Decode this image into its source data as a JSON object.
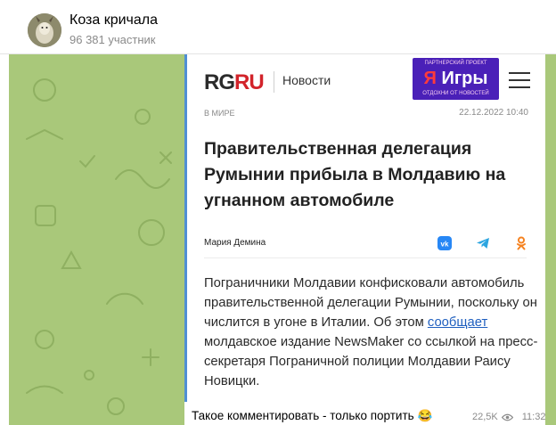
{
  "header": {
    "title": "Коза кричала",
    "subtitle": "96 381 участник"
  },
  "article": {
    "logo_rg": "RG",
    "logo_ru": "RU",
    "section": "Новости",
    "ad_top": "ПАРТНЕРСКИЙ ПРОЕКТ",
    "ad_ya": "Я",
    "ad_main": "Игры",
    "ad_bottom": "ОТДОХНИ ОТ НОВОСТЕЙ",
    "rubric": "В МИРЕ",
    "date": "22.12.2022 10:40",
    "headline": "Правительственная делегация Румынии прибыла в Молдавию на угнанном автомобиле",
    "author": "Мария Демина",
    "body_before_link": "Пограничники Молдавии конфисковали автомобиль правительственной делегации Румынии, поскольку он числится в угоне в Италии. Об этом ",
    "body_link": "сообщает",
    "body_after_link": " молдавское издание NewsMaker со ссылкой на пресс-секретаря Пограничной полиции Молдавии Раису Новицки."
  },
  "message": {
    "caption": "Такое комментировать - только портить 😂",
    "views": "22,5K",
    "time": "11:32"
  },
  "colors": {
    "chat_background": "#a9c87a",
    "quote_bar": "#4f8fd4",
    "logo_red": "#d2232a",
    "ad_purple": "#4a20b8",
    "link": "#1f5fbf"
  }
}
